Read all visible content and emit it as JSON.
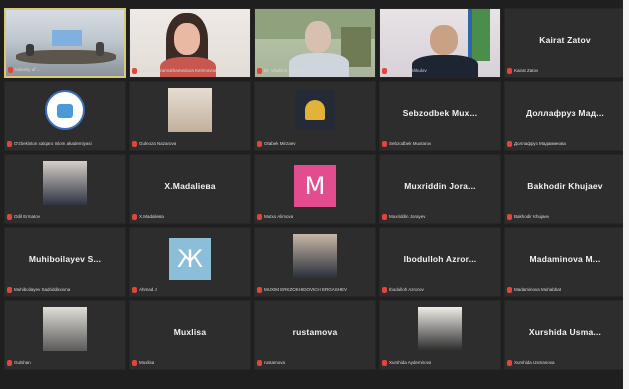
{
  "participants": [
    {
      "display": "video",
      "scene": "conference-room",
      "footer": "Ministry of ...",
      "active": true
    },
    {
      "display": "video",
      "scene": "woman",
      "footer": "Lazizа Mirzamukhamedova Kerimovna"
    },
    {
      "display": "video",
      "scene": "man-glasses",
      "footer": "Dr. Vladimir Bokharev"
    },
    {
      "display": "video",
      "scene": "man-flags",
      "footer": "Ulugbek Tashkulov"
    },
    {
      "display": "name",
      "name": "Kairat Zatov",
      "footer": "Kairat Zatov"
    },
    {
      "display": "image",
      "image": "logo-circle",
      "footer": "O'zbekiston xalqaro Islom akademiyasi"
    },
    {
      "display": "image",
      "image": "photo-woman",
      "footer": "Gulnoza Nazarova"
    },
    {
      "display": "image",
      "image": "logo-dark",
      "footer": "Otabek Mirzaev"
    },
    {
      "display": "name",
      "name": "Sebzodbek Mux...",
      "footer": "Sebzodbek Muxtarov"
    },
    {
      "display": "name",
      "name": "Доллaфруз Мад...",
      "footer": "Доллaфруз Мадаминова"
    },
    {
      "display": "image",
      "image": "photo-man",
      "footer": "Odil Ermatov"
    },
    {
      "display": "name",
      "name": "X.Madaliева",
      "footer": "X.Madaliева"
    },
    {
      "display": "letter",
      "letter": "M",
      "bg": "#e34c8e",
      "footer": "Mutxo Alimova"
    },
    {
      "display": "name",
      "name": "Muxriddin Jora...",
      "footer": "Muxriddin Jorayev"
    },
    {
      "display": "name",
      "name": "Bakhodir Khujaev",
      "footer": "Bakhodir Khujaev"
    },
    {
      "display": "name",
      "name": "Muhiboilayev S...",
      "footer": "Muhiboilayev Sadriddinovna"
    },
    {
      "display": "letter",
      "letter": "Ж",
      "bg": "#8bbfd9",
      "footer": "Ahmad J"
    },
    {
      "display": "image",
      "image": "photo-man-2",
      "footer": "MUXIM ERKZOKHIDOVICH ERGASHEV"
    },
    {
      "display": "name",
      "name": "Ibodulloh Azror...",
      "footer": "Ibodulloh Azrorov"
    },
    {
      "display": "name",
      "name": "Madaminova M...",
      "footer": "Madaminova Muhabbat"
    },
    {
      "display": "image",
      "image": "photo-man-3",
      "footer": "Gulshan"
    },
    {
      "display": "name",
      "name": "Muxlisa",
      "footer": "Muxlisa"
    },
    {
      "display": "name",
      "name": "rustamova",
      "footer": "rustamova"
    },
    {
      "display": "image",
      "image": "photo-woman-2",
      "footer": "Xurshida Aydemirova"
    },
    {
      "display": "name",
      "name": "Xurshida Usma...",
      "footer": "Xurshida Usmanova"
    }
  ],
  "colors": {
    "background": "#1f1f1f",
    "tile": "#2d2d2d",
    "active_border": "#d9c77a",
    "mic_muted": "#e2453c"
  },
  "icons": {
    "mic": "microphone-muted-icon"
  }
}
